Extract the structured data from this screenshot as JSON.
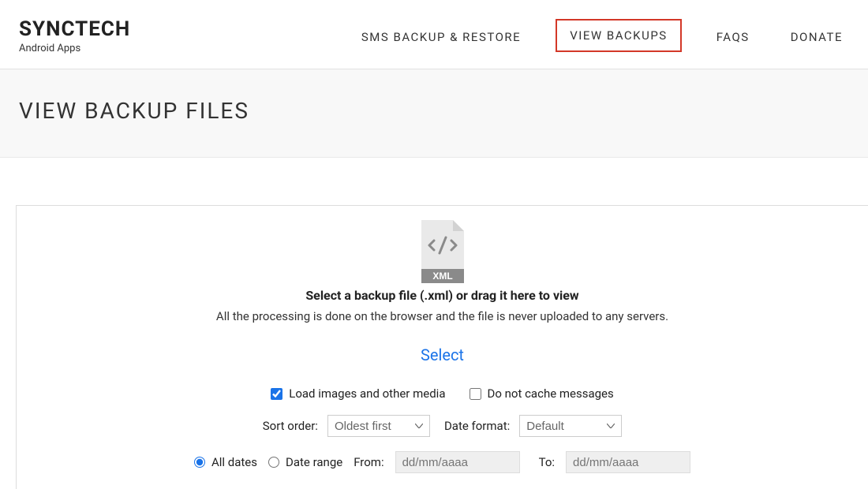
{
  "brand": {
    "title": "SYNCTECH",
    "subtitle": "Android Apps"
  },
  "nav": {
    "items": [
      {
        "label": "SMS BACKUP & RESTORE",
        "highlighted": false
      },
      {
        "label": "VIEW BACKUPS",
        "highlighted": true
      },
      {
        "label": "FAQS",
        "highlighted": false
      },
      {
        "label": "DONATE",
        "highlighted": false
      }
    ]
  },
  "page": {
    "title": "VIEW BACKUP FILES"
  },
  "upload": {
    "icon_badge": "XML",
    "prompt": "Select a backup file (.xml) or drag it here to view",
    "subtext": "All the processing is done on the browser and the file is never uploaded to any servers.",
    "select_label": "Select"
  },
  "options": {
    "load_media": {
      "label": "Load images and other media",
      "checked": true
    },
    "no_cache": {
      "label": "Do not cache messages",
      "checked": false
    },
    "sort_label": "Sort order:",
    "sort_value": "Oldest first",
    "fmt_label": "Date format:",
    "fmt_value": "Default"
  },
  "dates": {
    "all_label": "All dates",
    "range_label": "Date range",
    "mode": "all",
    "from_label": "From:",
    "to_label": "To:",
    "placeholder": "dd/mm/aaaa"
  }
}
